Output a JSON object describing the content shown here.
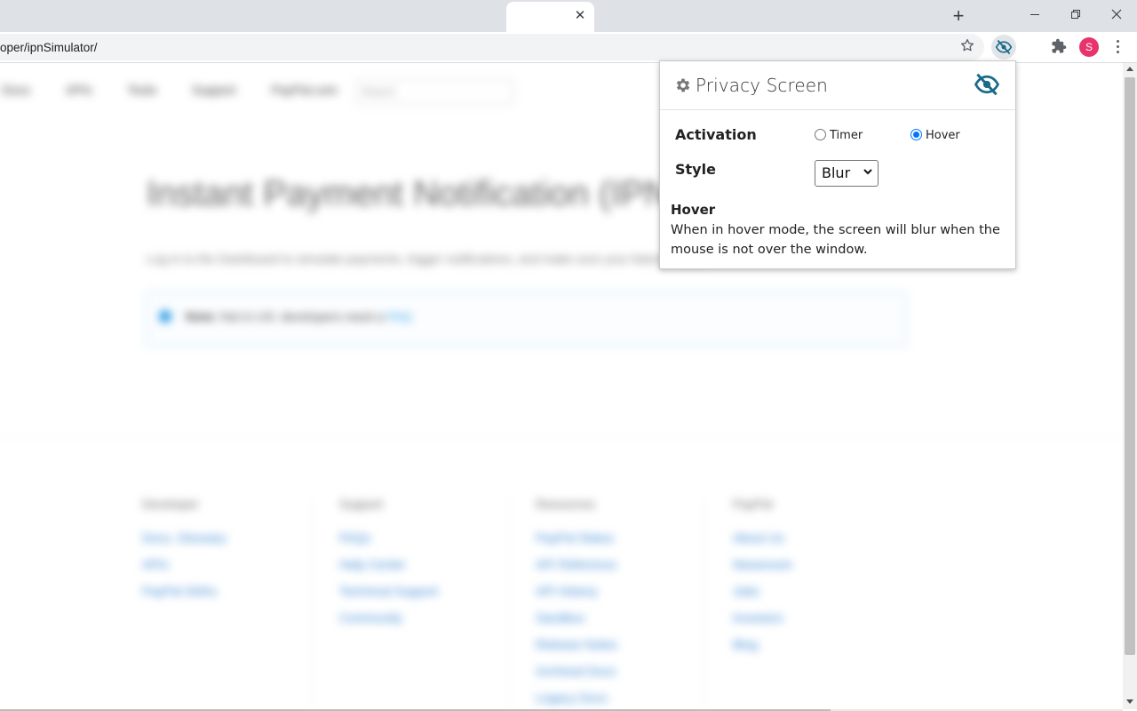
{
  "browser": {
    "tab_close_glyph": "✕",
    "new_tab_glyph": "+",
    "url": "oper/ipnSimulator/",
    "profile_initial": "S",
    "avatar_color": "#e8336d"
  },
  "page": {
    "nav_items": [
      "Docs",
      "APIs",
      "Tools",
      "Support",
      "PayPal.com"
    ],
    "search_placeholder": "Search",
    "hero_title": "Instant Payment Notification (IPN) simulator",
    "hero_subtitle": "Log in to the Dashboard to simulate payments, trigger notifications, and make sure your listener works.",
    "note_bold": "Note:",
    "note_text": " Not in US: developers need a",
    "note_link": "FAQ",
    "footer_columns": [
      {
        "heading": "Developer",
        "links": [
          "Docs, Glossary",
          "APIs",
          "PayPal SDKs"
        ]
      },
      {
        "heading": "Support",
        "links": [
          "FAQs",
          "Help Center",
          "Technical Support",
          "Community"
        ]
      },
      {
        "heading": "Resources",
        "links": [
          "PayPal Status",
          "API Reference",
          "API History",
          "Sandbox",
          "Release Notes",
          "Archived Docs",
          "Legacy Docs"
        ]
      },
      {
        "heading": "PayPal",
        "links": [
          "About Us",
          "Newsroom",
          "Jobs",
          "Investors",
          "Blog"
        ]
      }
    ]
  },
  "popup": {
    "title": "Privacy Screen",
    "accent_color": "#1a6a8a",
    "activation_label": "Activation",
    "activation_options": [
      {
        "label": "Timer",
        "checked": false
      },
      {
        "label": "Hover",
        "checked": true
      }
    ],
    "style_label": "Style",
    "style_value": "Blur",
    "help_title": "Hover",
    "help_text": "When in hover mode, the screen will blur when the mouse is not over the window."
  }
}
